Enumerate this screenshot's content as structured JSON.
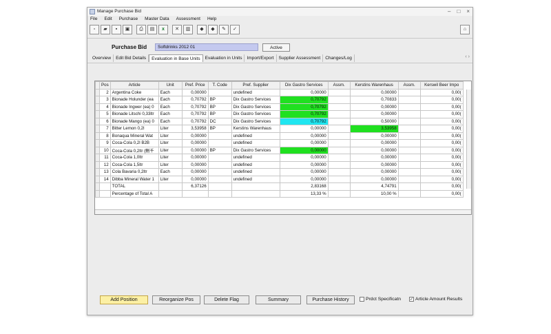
{
  "window": {
    "title": "Manage Purchase Bid"
  },
  "menu": [
    "File",
    "Edit",
    "Purchase",
    "Master Data",
    "Assessment",
    "Help"
  ],
  "toolbar_icons": [
    "new-icon",
    "open-icon",
    "save-icon",
    "save-as-icon",
    "print-icon",
    "print-preview-icon",
    "excel-icon",
    "delete-icon",
    "chart-icon",
    "arrow-left-icon",
    "arrow-right-icon",
    "edit-icon",
    "check-icon"
  ],
  "bid": {
    "label": "Purchase Bid",
    "name": "Softdrinks 2012 01",
    "status": "Active"
  },
  "tabs": [
    "Overview",
    "Edit Bid Details",
    "Evaluation in Base Units",
    "Evaluation in Units",
    "Import/Export",
    "Supplier Assessment",
    "Changes/Log"
  ],
  "table": {
    "headers": [
      "Pos",
      "Article",
      "Unit",
      "Pref. Price",
      "T. Code",
      "Pref. Supplier",
      "Dix Gastro Services",
      "Assm.",
      "Kerstins Warenhaus",
      "Assm.",
      "Kerswil Beer Impo"
    ],
    "rows": [
      [
        "2",
        "Argentina Coke",
        "Each",
        "0,00000",
        "",
        "undefined",
        "0,00000",
        "",
        "0,00000",
        "",
        "0,00("
      ],
      [
        "3",
        "Bionade Holunder (ea",
        "Each",
        "0,70792",
        "BP",
        "Dix Gastro Services",
        "0,70792",
        "",
        "0,70833",
        "",
        "0,00("
      ],
      [
        "4",
        "Bionade Ingwer (ea) 0",
        "Each",
        "0,70792",
        "BP",
        "Dix Gastro Services",
        "0,70792",
        "",
        "0,00000",
        "",
        "0,00("
      ],
      [
        "5",
        "Bionade Litschi 0,33ltr",
        "Each",
        "0,70792",
        "BP",
        "Dix Gastro Services",
        "0,70792",
        "",
        "0,00000",
        "",
        "0,00("
      ],
      [
        "6",
        "Bionade Mango (ea) 0",
        "Each",
        "0,70792",
        "DC",
        "Dix Gastro Services",
        "0,70792",
        "",
        "0,50000",
        "",
        "0,00("
      ],
      [
        "7",
        "Bitter Lemon 0,2l",
        "Liter",
        "3,53958",
        "BP",
        "Kerstins Warenhaus",
        "0,00000",
        "",
        "3,53958",
        "",
        "0,00("
      ],
      [
        "8",
        "Bonaqua Mineral Wat",
        "Liter",
        "0,00000",
        "",
        "undefined",
        "0,00000",
        "",
        "0,00000",
        "",
        "0,00("
      ],
      [
        "9",
        "Coca-Cola 0,2l B2B",
        "Liter",
        "0,00000",
        "",
        "undefined",
        "0,00000",
        "",
        "0,00000",
        "",
        "0,00("
      ],
      [
        "10",
        "Coca-Cola 0,2ltr (刪千",
        "Liter",
        "0,00000",
        "BP",
        "Dix Gastro Services",
        "0,00000",
        "",
        "0,00000",
        "",
        "0,00("
      ],
      [
        "11",
        "Coca-Cola 1,0ltr",
        "Liter",
        "0,00000",
        "",
        "undefined",
        "0,00000",
        "",
        "0,00000",
        "",
        "0,00("
      ],
      [
        "12",
        "Coca-Cola 1,5ltr",
        "Liter",
        "0,00000",
        "",
        "undefined",
        "0,00000",
        "",
        "0,00000",
        "",
        "0,00("
      ],
      [
        "13",
        "Cola Bavaria 0,2ltr",
        "Each",
        "0,00000",
        "",
        "undefined",
        "0,00000",
        "",
        "0,00000",
        "",
        "0,00("
      ],
      [
        "14",
        "Dibba Mineral Water 1",
        "Liter",
        "0,00000",
        "",
        "undefined",
        "0,00000",
        "",
        "0,00000",
        "",
        "0,00("
      ]
    ],
    "highlight_green": [
      [
        1,
        6
      ],
      [
        2,
        6
      ],
      [
        3,
        6
      ],
      [
        5,
        8
      ],
      [
        8,
        6
      ]
    ],
    "highlight_cyan": [
      [
        4,
        6
      ]
    ],
    "totals": [
      [
        "",
        "TOTAL",
        "",
        "6,37126",
        "",
        "",
        "2,83168",
        "",
        "4,74791",
        "",
        "0,00("
      ],
      [
        "",
        "Percentage of Total A",
        "",
        "",
        "",
        "",
        "13,33 %",
        "",
        "10,00 %",
        "",
        "0,00("
      ]
    ]
  },
  "buttons": {
    "add_position": "Add Position",
    "reorganize": "Reorganize Pos",
    "delete_flag": "Delete Flag",
    "summary": "Summary",
    "purchase_history": "Purchase History"
  },
  "checkboxes": {
    "product_spec": {
      "label": "Prdct Specificatn",
      "checked": false
    },
    "article_amount": {
      "label": "Article Amount Results",
      "checked": true
    }
  },
  "colors": {
    "green": "#20e020",
    "cyan": "#20e6f0",
    "bid_name_bg": "#c4c9ef",
    "primary_button": "#fcf0a4"
  }
}
